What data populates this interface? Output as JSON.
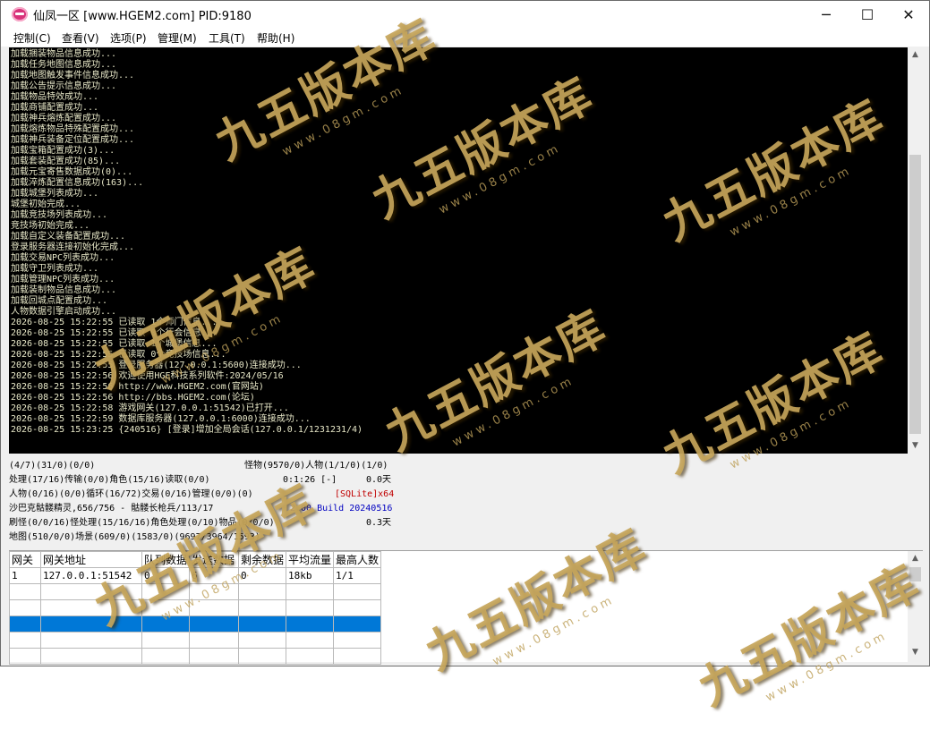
{
  "window": {
    "title": "仙凤一区 [www.HGEM2.com] PID:9180",
    "min_label": "─",
    "max_label": "☐",
    "close_label": "✕"
  },
  "menu": [
    "控制(C)",
    "查看(V)",
    "选项(P)",
    "管理(M)",
    "工具(T)",
    "帮助(H)"
  ],
  "log_lines": [
    "加载捆装物品信息成功...",
    "加载任务地图信息成功...",
    "加载地图触发事件信息成功...",
    "加载公告提示信息成功...",
    "加载物品特效成功...",
    "加载商铺配置成功...",
    "加载神兵熔炼配置成功...",
    "加载熔炼物品特殊配置成功...",
    "加载神兵装备定位配置成功...",
    "加载宝箱配置成功(3)...",
    "加载套装配置成功(85)...",
    "加载元宝寄售数据成功(0)...",
    "加载淬炼配置信息成功(163)...",
    "加载城堡列表成功...",
    "城堡初始完成...",
    "加载竞技场列表成功...",
    "竞技场初始完成...",
    "加载自定义装备配置成功...",
    "登录服务器连接初始化完成...",
    "加载交易NPC列表成功...",
    "加载守卫列表成功...",
    "加载管理NPC列表成功...",
    "加载装制物品信息成功...",
    "加载回城点配置成功...",
    "人物数据引擎启动成功...",
    "2026-08-25 15:22:55 已读取 1个师门信息...",
    "2026-08-25 15:22:55 已读取 0个行会信息...",
    "2026-08-25 15:22:55 已读取 1个城堡信息...",
    "2026-08-25 15:22:55 已读取 0个竞技场信息...",
    "2026-08-25 15:22:55 登录服务器(127.0.0.1:5600)连接成功...",
    "2026-08-25 15:22:56 欢迎使用HGE科技系列软件:2024/05/16",
    "2026-08-25 15:22:56 http://www.HGEM2.com(官网站)",
    "2026-08-25 15:22:56 http://bbs.HGEM2.com(论坛)",
    "2026-08-25 15:22:58 游戏网关(127.0.0.1:51542)已打开...",
    "2026-08-25 15:22:59 数据库服务器(127.0.0.1:6000)连接成功...",
    "2026-08-25 15:23:25 {240516} [登录]增加全局会话(127.0.0.1/1231231/4)"
  ],
  "status": {
    "row1": "(4/7)(31/0)(0/0)",
    "row1_right": "怪物(9570/0)人物(1/1/0)(1/0)",
    "row2": "处理(17/16)传输(0/0)角色(15/16)读取(0/0)",
    "row2_time": "0:1:26 [-]",
    "row2_days": "0.0天",
    "row3": "人物(0/16)(0/0)循环(16/72)交易(0/16)管理(0/0)(0)",
    "row3_right": "[SQLite]x64",
    "row3_color": "#c00000",
    "row4": "沙巴克骷髅精灵,656/756 - 骷髅长枪兵/113/17",
    "row4_right": "2.00 Build 20240516",
    "row4_color": "#0000c0",
    "row5": "刷怪(0/0/16)怪处理(15/16/16)角色处理(0/10)物品(0/0/0)",
    "row5_right": "0.3天",
    "row6": "地图(510/0/0)场景(609/0)(1583/0)(9697/3964/1593)"
  },
  "table": {
    "headers": [
      "网关",
      "网关地址",
      "队列数据",
      "发送数据",
      "剩余数据",
      "平均流量",
      "最高人数"
    ],
    "rows": [
      [
        "1",
        "127.0.0.1:51542",
        "0",
        "6",
        "0",
        "18kb",
        "1/1"
      ],
      [
        "",
        "",
        "",
        "",
        "",
        "",
        ""
      ],
      [
        "",
        "",
        "",
        "",
        "",
        "",
        ""
      ],
      [
        "",
        "",
        "",
        "",
        "",
        "",
        ""
      ],
      [
        "",
        "",
        "",
        "",
        "",
        "",
        ""
      ],
      [
        "",
        "",
        "",
        "",
        "",
        "",
        ""
      ]
    ],
    "selected_row": 3
  },
  "watermark": {
    "main": "九五版本库",
    "url": "www.08gm.com"
  },
  "colors": {
    "console_bg": "#000000",
    "console_text": "#e8e8c8",
    "selection": "#0078d7"
  }
}
